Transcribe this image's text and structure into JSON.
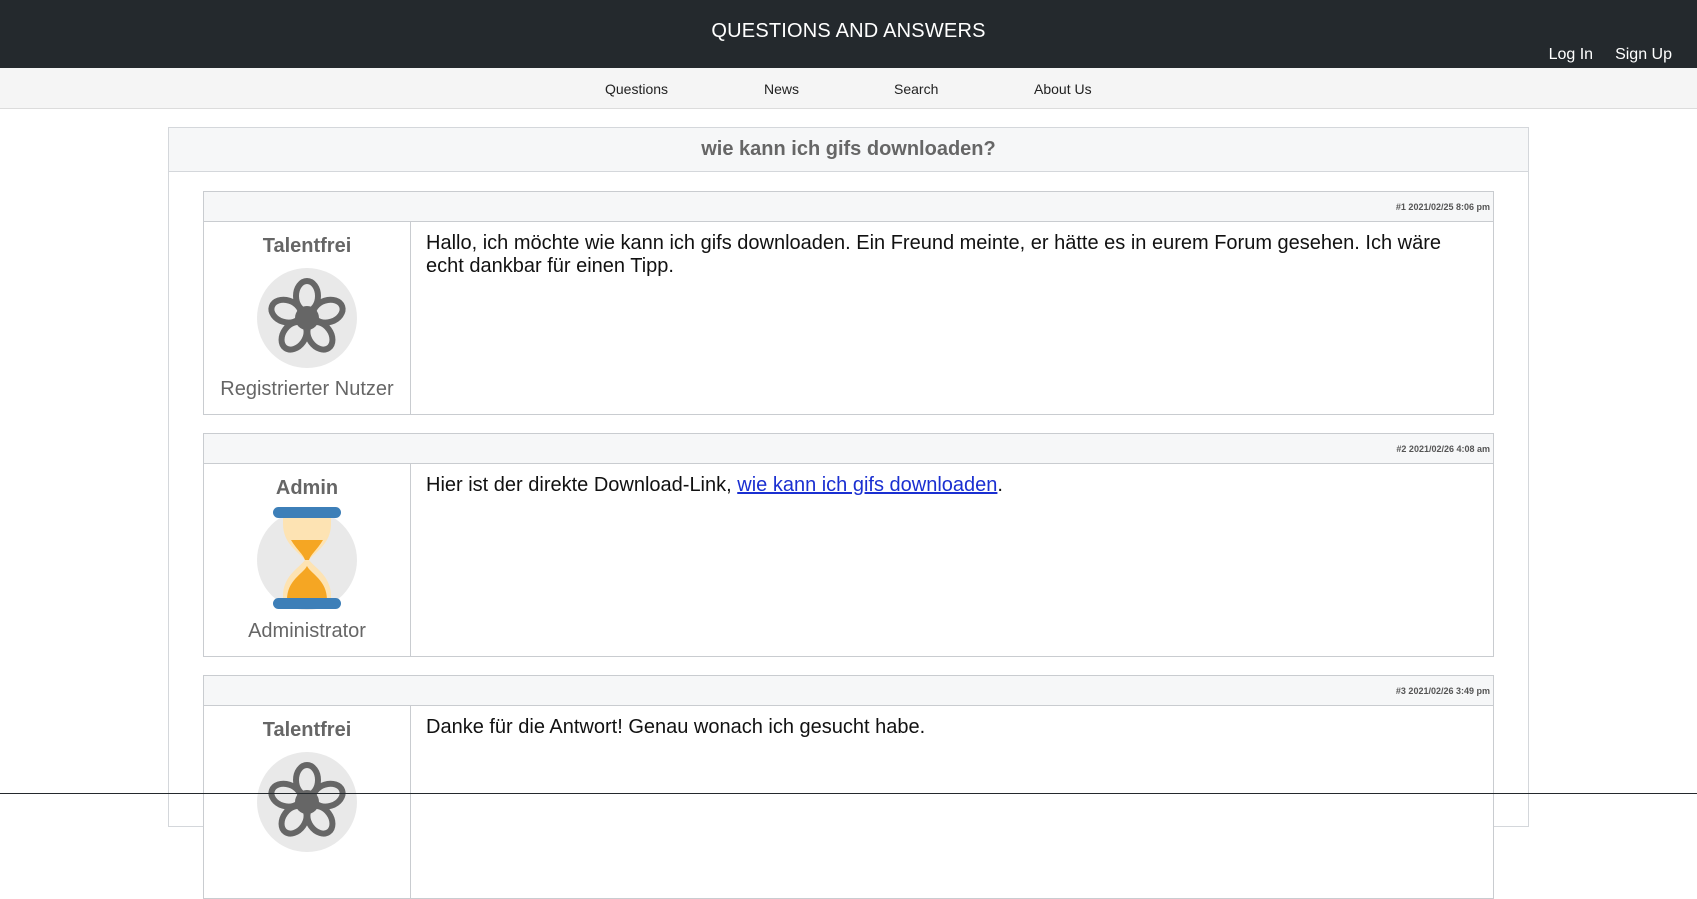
{
  "header": {
    "title": "QUESTIONS AND ANSWERS",
    "login_label": "Log In",
    "signup_label": "Sign Up"
  },
  "nav": {
    "items": [
      {
        "label": "Questions"
      },
      {
        "label": "News"
      },
      {
        "label": "Search"
      },
      {
        "label": "About Us"
      }
    ]
  },
  "thread": {
    "title": "wie kann ich gifs downloaden?",
    "posts": [
      {
        "meta": "#1 2021/02/25 8:06 pm",
        "author": "Talentfrei",
        "avatar_icon": "flower-icon",
        "role": "Registrierter Nutzer",
        "text": "Hallo, ich möchte wie kann ich gifs downloaden. Ein Freund meinte, er hätte es in eurem Forum gesehen. Ich wäre echt dankbar für einen Tipp."
      },
      {
        "meta": "#2 2021/02/26 4:08 am",
        "author": "Admin",
        "avatar_icon": "hourglass-icon",
        "role": "Administrator",
        "text_before": "Hier ist der direkte Download-Link, ",
        "link_text": "wie kann ich gifs downloaden",
        "text_after": "."
      },
      {
        "meta": "#3 2021/02/26 3:49 pm",
        "author": "Talentfrei",
        "avatar_icon": "flower-icon",
        "role": "",
        "text": "Danke für die Antwort! Genau wonach ich gesucht habe."
      }
    ]
  },
  "colors": {
    "header_bg": "#24292d",
    "link": "#1a2fd1",
    "hourglass_sand": "#f5a623",
    "hourglass_frame": "#3d7fb8"
  }
}
